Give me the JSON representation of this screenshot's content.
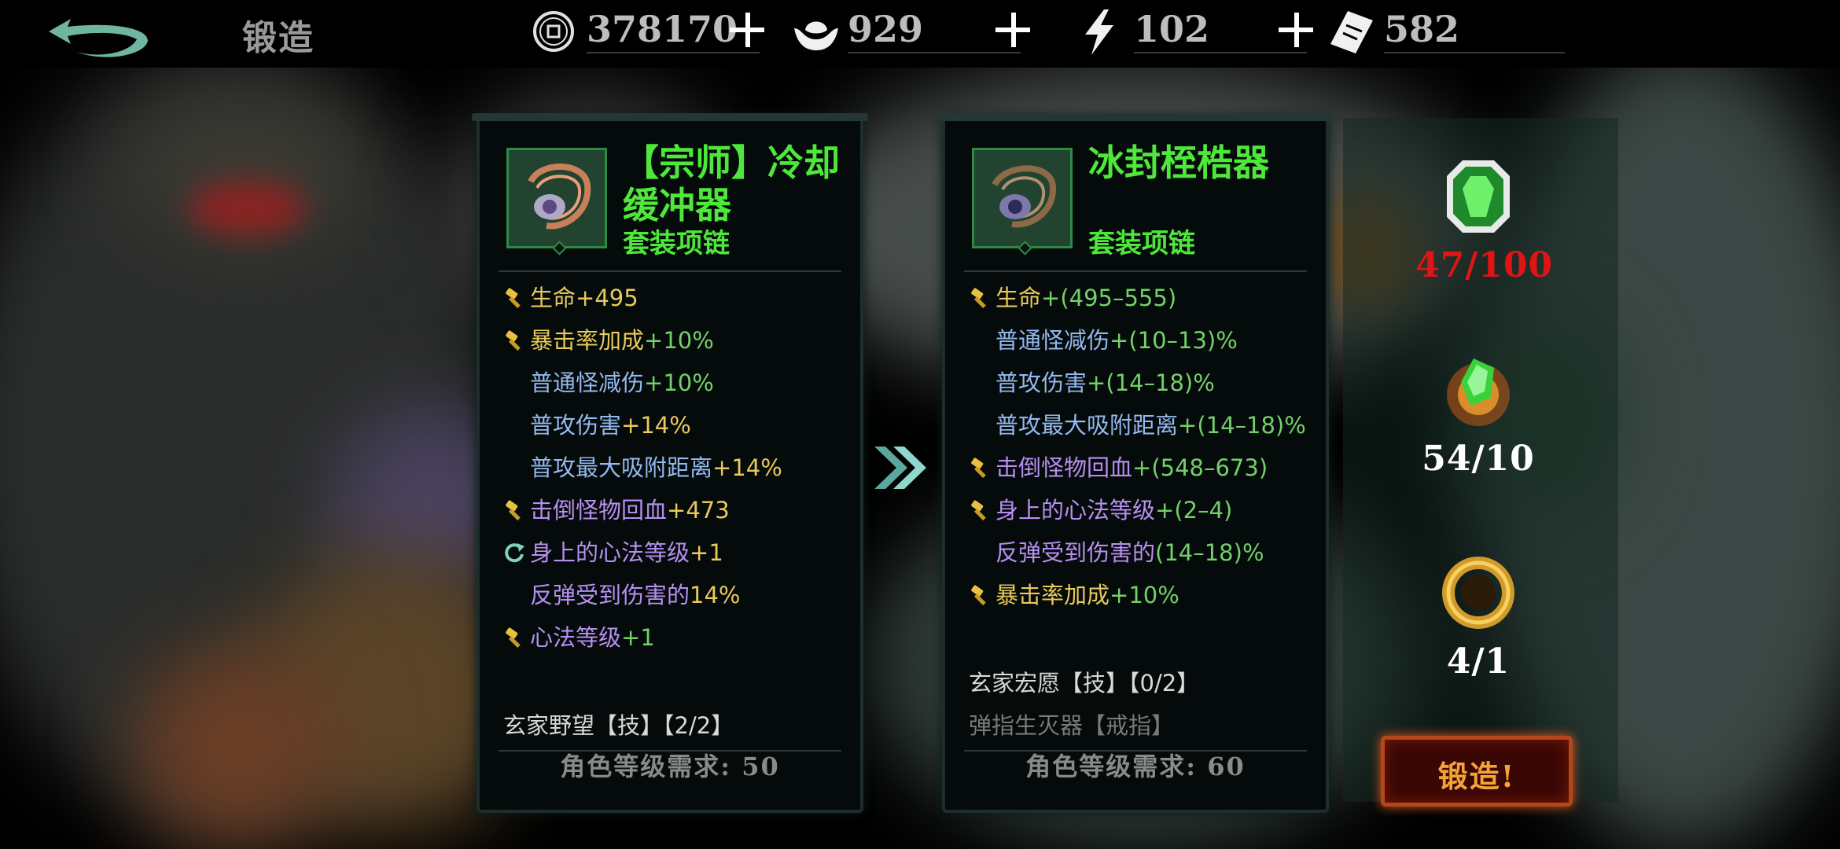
{
  "header": {
    "title": "锻造",
    "resources": [
      {
        "name": "coin",
        "icon": "coin-icon",
        "value": "378170"
      },
      {
        "name": "silver",
        "icon": "silver-ingot-icon",
        "value": "929"
      },
      {
        "name": "energy",
        "icon": "lightning-icon",
        "value": "102"
      },
      {
        "name": "ticket",
        "icon": "ticket-icon",
        "value": "582"
      }
    ]
  },
  "current_item": {
    "name_line1": "【宗师】冷却",
    "name_line2": "缓冲器",
    "type": "套装项链",
    "stats": [
      {
        "icon": "hammer-icon",
        "label": "生命",
        "value": "+495",
        "label_color": "#e8c95a",
        "value_color": "#e8c95a"
      },
      {
        "icon": "hammer-icon",
        "label": "暴击率加成",
        "value": "+10%",
        "label_color": "#e8c95a",
        "value_color": "#74d06a"
      },
      {
        "icon": "",
        "label": "普通怪减伤",
        "value": "+10%",
        "label_color": "#93b9ef",
        "value_color": "#74d06a"
      },
      {
        "icon": "",
        "label": "普攻伤害",
        "value": "+14%",
        "label_color": "#93b9ef",
        "value_color": "#e8c95a"
      },
      {
        "icon": "",
        "label": "普攻最大吸附距离",
        "value": "+14%",
        "label_color": "#93b9ef",
        "value_color": "#e8c95a"
      },
      {
        "icon": "hammer-icon",
        "label": "击倒怪物回血",
        "value": "+473",
        "label_color": "#b690f0",
        "value_color": "#e8c95a"
      },
      {
        "icon": "refresh-icon",
        "label": "身上的心法等级",
        "value": "+1",
        "label_color": "#b690f0",
        "value_color": "#e8c95a"
      },
      {
        "icon": "",
        "label": "反弹受到伤害的",
        "value": "14%",
        "label_color": "#b690f0",
        "value_color": "#e8c95a"
      },
      {
        "icon": "hammer-icon",
        "label": "心法等级",
        "value": "+1",
        "label_color": "#b690f0",
        "value_color": "#74d06a"
      }
    ],
    "set_skills": [
      "玄家野望【技】【2/2】"
    ],
    "level_req": "角色等级需求: 50"
  },
  "target_item": {
    "name_line1": "冰封桎梏器",
    "name_line2": "",
    "type": "套装项链",
    "stats": [
      {
        "icon": "hammer-icon",
        "label": "生命",
        "value": "+(495–555)",
        "label_color": "#e8c95a",
        "value_color": "#74d06a"
      },
      {
        "icon": "",
        "label": "普通怪减伤",
        "value": "+(10–13)%",
        "label_color": "#93b9ef",
        "value_color": "#74d06a"
      },
      {
        "icon": "",
        "label": "普攻伤害",
        "value": "+(14–18)%",
        "label_color": "#93b9ef",
        "value_color": "#74d06a"
      },
      {
        "icon": "",
        "label": "普攻最大吸附距离",
        "value": "+(14–18)%",
        "label_color": "#93b9ef",
        "value_color": "#74d06a"
      },
      {
        "icon": "hammer-icon",
        "label": "击倒怪物回血",
        "value": "+(548–673)",
        "label_color": "#b690f0",
        "value_color": "#74d06a"
      },
      {
        "icon": "hammer-icon",
        "label": "身上的心法等级",
        "value": "+(2–4)",
        "label_color": "#b690f0",
        "value_color": "#74d06a"
      },
      {
        "icon": "",
        "label": "反弹受到伤害的",
        "value": "(14–18)%",
        "label_color": "#b690f0",
        "value_color": "#74d06a"
      },
      {
        "icon": "hammer-icon",
        "label": "暴击率加成",
        "value": "+10%",
        "label_color": "#e8c95a",
        "value_color": "#74d06a"
      }
    ],
    "set_skills": [
      "玄家宏愿【技】【0/2】",
      "弹指生灭器【戒指】"
    ],
    "level_req": "角色等级需求: 60"
  },
  "materials": [
    {
      "icon": "green-gem-icon",
      "count": "47/100",
      "insufficient": true
    },
    {
      "icon": "fire-crystal-icon",
      "count": "54/10",
      "insufficient": false
    },
    {
      "icon": "golden-ring-icon",
      "count": "4/1",
      "insufficient": false
    }
  ],
  "forge_button": "锻造!",
  "colors": {
    "name_green": "#4ee83a",
    "insufficient_red": "#e01414",
    "forge_orange": "#f5a335"
  }
}
